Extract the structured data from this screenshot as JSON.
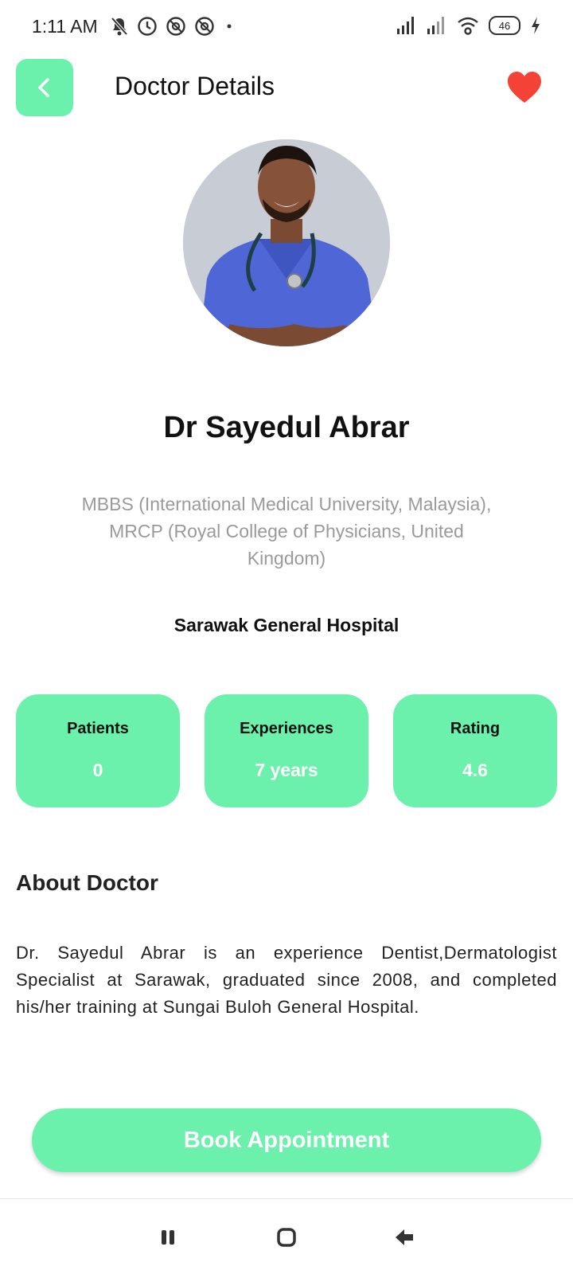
{
  "status_bar": {
    "time": "1:11 AM",
    "battery": "46",
    "icons_left": [
      "mute-icon",
      "alarm-icon",
      "do-not-disturb-icon",
      "do-not-disturb-icon",
      "dot-icon"
    ],
    "icons_right": [
      "signal-icon",
      "signal-icon",
      "wifi-icon",
      "battery-icon",
      "charging-icon"
    ]
  },
  "header": {
    "title": "Doctor Details",
    "back_icon": "chevron-left-icon",
    "favorite_icon": "heart-icon",
    "favorite_color": "#f44336"
  },
  "doctor": {
    "name": "Dr Sayedul Abrar",
    "qualification": "MBBS (International Medical University, Malaysia), MRCP (Royal College of Physicians, United Kingdom)",
    "hospital": "Sarawak General Hospital"
  },
  "stats": [
    {
      "label": "Patients",
      "value": "0"
    },
    {
      "label": "Experiences",
      "value": "7 years"
    },
    {
      "label": "Rating",
      "value": "4.6"
    }
  ],
  "about": {
    "title": "About Doctor",
    "text": "Dr. Sayedul Abrar is an experience Dentist,Dermatologist Specialist at Sarawak, graduated since 2008, and completed his/her training at Sungai Buloh General Hospital."
  },
  "actions": {
    "book_label": "Book Appointment"
  },
  "colors": {
    "accent": "#6cf1ad",
    "muted_text": "#9a9a9a"
  },
  "nav": [
    "recents-icon",
    "home-icon",
    "back-arrow-icon"
  ]
}
